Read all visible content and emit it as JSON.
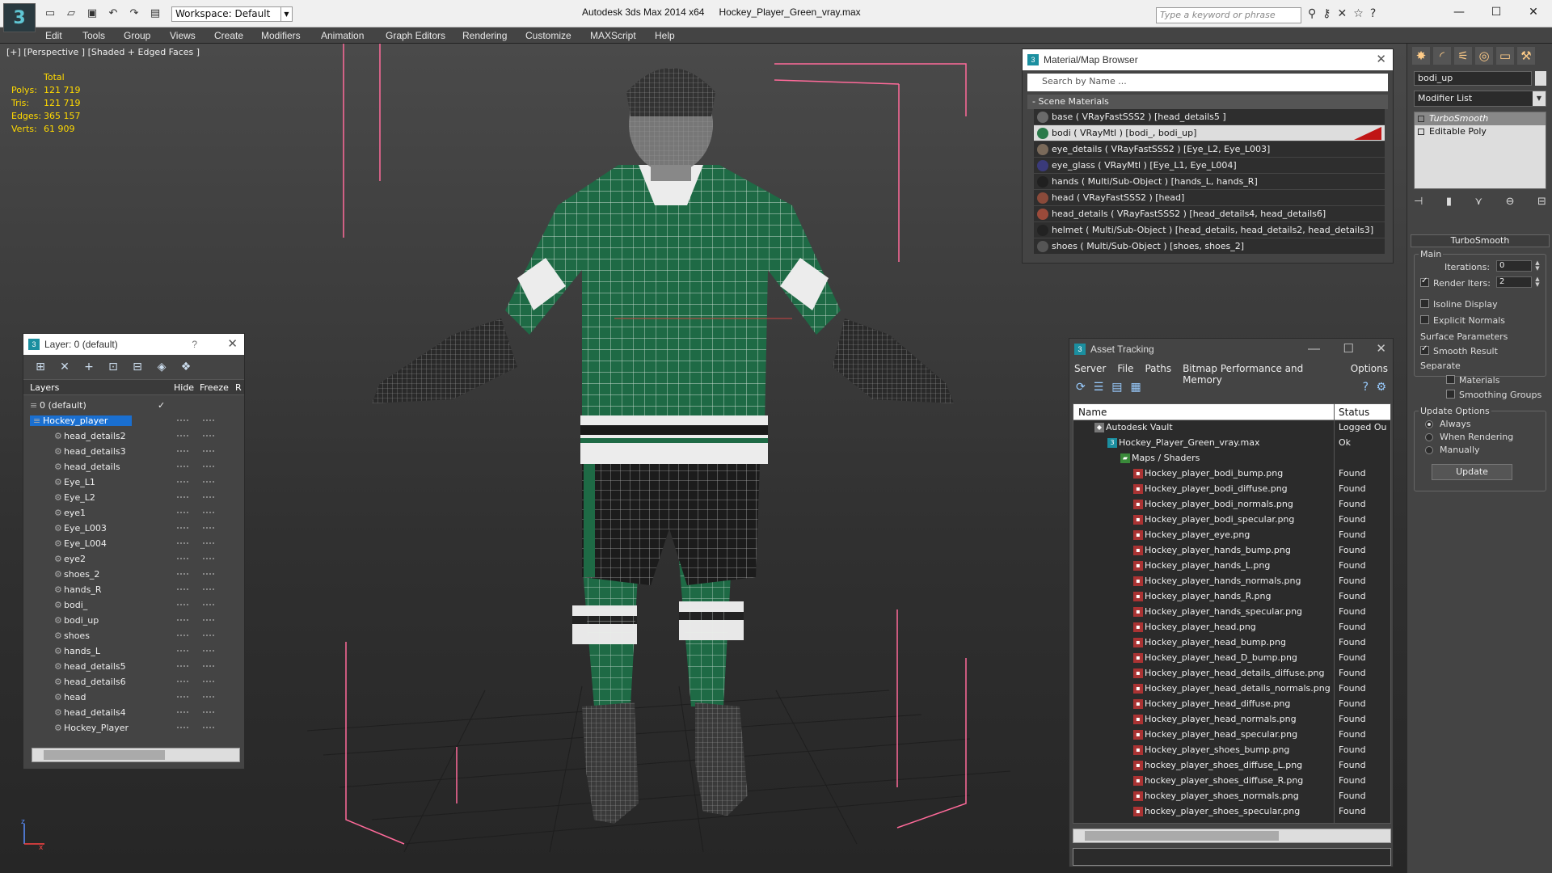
{
  "titlebar": {
    "workspace": "Workspace: Default",
    "app": "Autodesk 3ds Max  2014 x64",
    "file": "Hockey_Player_Green_vray.max",
    "search_placeholder": "Type a keyword or phrase"
  },
  "menu": [
    "Edit",
    "Tools",
    "Group",
    "Views",
    "Create",
    "Modifiers",
    "Animation",
    "Graph Editors",
    "Rendering",
    "Customize",
    "MAXScript",
    "Help"
  ],
  "viewport": {
    "label": "[+] [Perspective ] [Shaded + Edged Faces ]",
    "stats": {
      "header": "Total",
      "rows": [
        {
          "k": "Polys:",
          "v": "121 719"
        },
        {
          "k": "Tris:",
          "v": "121 719"
        },
        {
          "k": "Edges:",
          "v": "365 157"
        },
        {
          "k": "Verts:",
          "v": "61 909"
        }
      ]
    },
    "axis": {
      "z": "z",
      "x": "x"
    }
  },
  "layers": {
    "title": "Layer: 0 (default)",
    "help": "?",
    "col_layers": "Layers",
    "col_hide": "Hide",
    "col_freeze": "Freeze",
    "col_r": "R",
    "items": [
      "0 (default)",
      "Hockey_player",
      "head_details2",
      "head_details3",
      "head_details",
      "Eye_L1",
      "Eye_L2",
      "eye1",
      "Eye_L003",
      "Eye_L004",
      "eye2",
      "shoes_2",
      "hands_R",
      "bodi_",
      "bodi_up",
      "shoes",
      "hands_L",
      "head_details5",
      "head_details6",
      "head",
      "head_details4",
      "Hockey_Player"
    ]
  },
  "materials": {
    "title": "Material/Map Browser",
    "search": "Search by Name ...",
    "section": "- Scene Materials",
    "items": [
      {
        "label": "base  ( VRayFastSSS2 )  [head_details5 ]",
        "color": "#6a6a6a"
      },
      {
        "label": "bodi  ( VRayMtl )  [bodi_, bodi_up]",
        "color": "#2a7a4a"
      },
      {
        "label": "eye_details  ( VRayFastSSS2 )  [Eye_L2, Eye_L003]",
        "color": "#7a6a5a"
      },
      {
        "label": "eye_glass  ( VRayMtl )  [Eye_L1, Eye_L004]",
        "color": "#3a3a7a"
      },
      {
        "label": "hands  ( Multi/Sub-Object )  [hands_L, hands_R]",
        "color": "#202020"
      },
      {
        "label": "head  ( VRayFastSSS2 )  [head]",
        "color": "#8a4a3a"
      },
      {
        "label": "head_details  ( VRayFastSSS2 )  [head_details4, head_details6]",
        "color": "#9a4a3a"
      },
      {
        "label": "helmet  ( Multi/Sub-Object )  [head_details, head_details2, head_details3]",
        "color": "#222222"
      },
      {
        "label": "shoes  ( Multi/Sub-Object )  [shoes, shoes_2]",
        "color": "#555555"
      }
    ]
  },
  "assets": {
    "title": "Asset Tracking",
    "menu": [
      "Server",
      "File",
      "Paths",
      "Bitmap Performance and Memory",
      "Options"
    ],
    "col_name": "Name",
    "col_status": "Status",
    "vault": {
      "name": "Autodesk Vault",
      "status": "Logged Ou"
    },
    "file": {
      "name": "Hockey_Player_Green_vray.max",
      "status": "Ok"
    },
    "maps_folder": "Maps / Shaders",
    "files": [
      {
        "name": "Hockey_player_bodi_bump.png",
        "status": "Found"
      },
      {
        "name": "Hockey_player_bodi_diffuse.png",
        "status": "Found"
      },
      {
        "name": "Hockey_player_bodi_normals.png",
        "status": "Found"
      },
      {
        "name": "Hockey_player_bodi_specular.png",
        "status": "Found"
      },
      {
        "name": "Hockey_player_eye.png",
        "status": "Found"
      },
      {
        "name": "Hockey_player_hands_bump.png",
        "status": "Found"
      },
      {
        "name": "Hockey_player_hands_L.png",
        "status": "Found"
      },
      {
        "name": "Hockey_player_hands_normals.png",
        "status": "Found"
      },
      {
        "name": "Hockey_player_hands_R.png",
        "status": "Found"
      },
      {
        "name": "Hockey_player_hands_specular.png",
        "status": "Found"
      },
      {
        "name": "Hockey_player_head.png",
        "status": "Found"
      },
      {
        "name": "Hockey_player_head_bump.png",
        "status": "Found"
      },
      {
        "name": "Hockey_player_head_D_bump.png",
        "status": "Found"
      },
      {
        "name": "Hockey_player_head_details_diffuse.png",
        "status": "Found"
      },
      {
        "name": "Hockey_player_head_details_normals.png",
        "status": "Found"
      },
      {
        "name": "Hockey_player_head_diffuse.png",
        "status": "Found"
      },
      {
        "name": "Hockey_player_head_normals.png",
        "status": "Found"
      },
      {
        "name": "Hockey_player_head_specular.png",
        "status": "Found"
      },
      {
        "name": "Hockey_player_shoes_bump.png",
        "status": "Found"
      },
      {
        "name": "hockey_player_shoes_diffuse_L.png",
        "status": "Found"
      },
      {
        "name": "hockey_player_shoes_diffuse_R.png",
        "status": "Found"
      },
      {
        "name": "hockey_player_shoes_normals.png",
        "status": "Found"
      },
      {
        "name": "hockey_player_shoes_specular.png",
        "status": "Found"
      }
    ]
  },
  "command": {
    "object_name": "bodi_up",
    "modifier_list": "Modifier List",
    "stack": [
      "TurboSmooth",
      "Editable Poly"
    ],
    "rollout": "TurboSmooth",
    "main_label": "Main",
    "iterations_label": "Iterations:",
    "iterations": "0",
    "render_iters_label": "Render Iters:",
    "render_iters": "2",
    "isoline": "Isoline Display",
    "explicit": "Explicit Normals",
    "surface_label": "Surface Parameters",
    "smooth_result": "Smooth Result",
    "separate": "Separate",
    "materials": "Materials",
    "smoothing_groups": "Smoothing Groups",
    "update_label": "Update Options",
    "always": "Always",
    "when_rendering": "When Rendering",
    "manually": "Manually",
    "update_btn": "Update"
  }
}
